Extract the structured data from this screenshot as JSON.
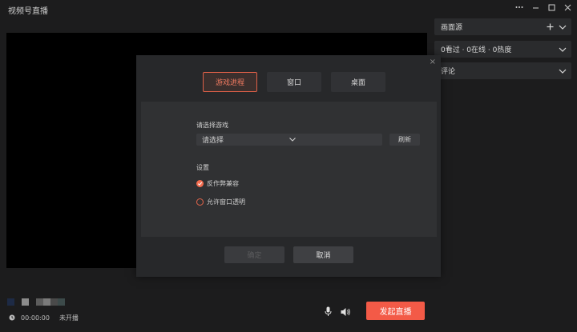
{
  "app": {
    "title": "视频号直播"
  },
  "window_controls": [
    "more-icon",
    "minimize-icon",
    "maximize-icon",
    "close-icon"
  ],
  "right_panel": {
    "rows": [
      {
        "label": "画面源",
        "icons": [
          "plus-icon",
          "chevron-down-icon"
        ]
      },
      {
        "label": "0看过 · 0在线 · 0热度",
        "icons": [
          "chevron-down-icon"
        ]
      },
      {
        "label": "评论",
        "icons": [
          "chevron-down-icon"
        ]
      }
    ]
  },
  "modal": {
    "close_glyph": "×",
    "tabs": [
      {
        "label": "游戏进程",
        "active": true
      },
      {
        "label": "窗口",
        "active": false
      },
      {
        "label": "桌面",
        "active": false
      }
    ],
    "select_game_label": "请选择游戏",
    "select_placeholder": "请选择",
    "refresh_label": "刷新",
    "settings_label": "设置",
    "options": [
      {
        "label": "反作弊兼容",
        "checked": true
      },
      {
        "label": "允许窗口透明",
        "checked": false
      }
    ],
    "confirm_label": "确定",
    "cancel_label": "取消"
  },
  "bottom": {
    "swatch_colors": [
      "#1d2a45",
      "#1c1c1d",
      "#8c8c8c",
      "#1c1c1d",
      "#5c5c5c",
      "#7a7a7a",
      "#4a4a4a",
      "#3c4a4a"
    ],
    "time": "00:00:00",
    "live_status": "未开播",
    "start_button": "发起直播"
  },
  "colors": {
    "accent": "#f35a47",
    "background": "#1c1c1d"
  }
}
